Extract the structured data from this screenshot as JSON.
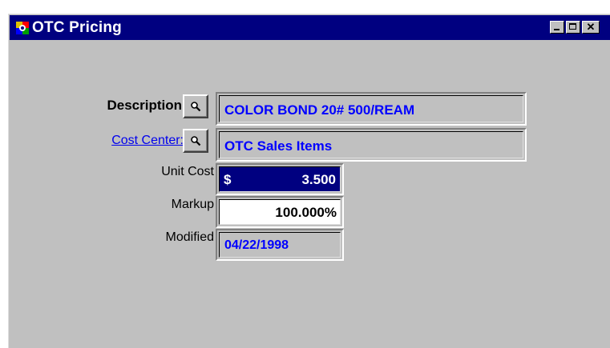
{
  "window": {
    "title": "OTC Pricing",
    "colors": {
      "titlebar": "#000080",
      "value_text": "#0000ff",
      "face": "#c0c0c0"
    }
  },
  "form": {
    "description": {
      "label": "Description",
      "value": "COLOR BOND 20# 500/REAM"
    },
    "cost_center": {
      "label": "Cost Center:",
      "value": "OTC Sales Items"
    },
    "unit_cost": {
      "label": "Unit Cost",
      "currency": "$",
      "value": "3.500"
    },
    "markup": {
      "label": "Markup",
      "value": "100.000%"
    },
    "modified": {
      "label": "Modified",
      "value": "04/22/1998"
    }
  },
  "icons": {
    "app": "app-icon",
    "lookup": "magnifier-icon",
    "minimize": "minimize-icon",
    "maximize": "maximize-icon",
    "close": "close-icon"
  }
}
